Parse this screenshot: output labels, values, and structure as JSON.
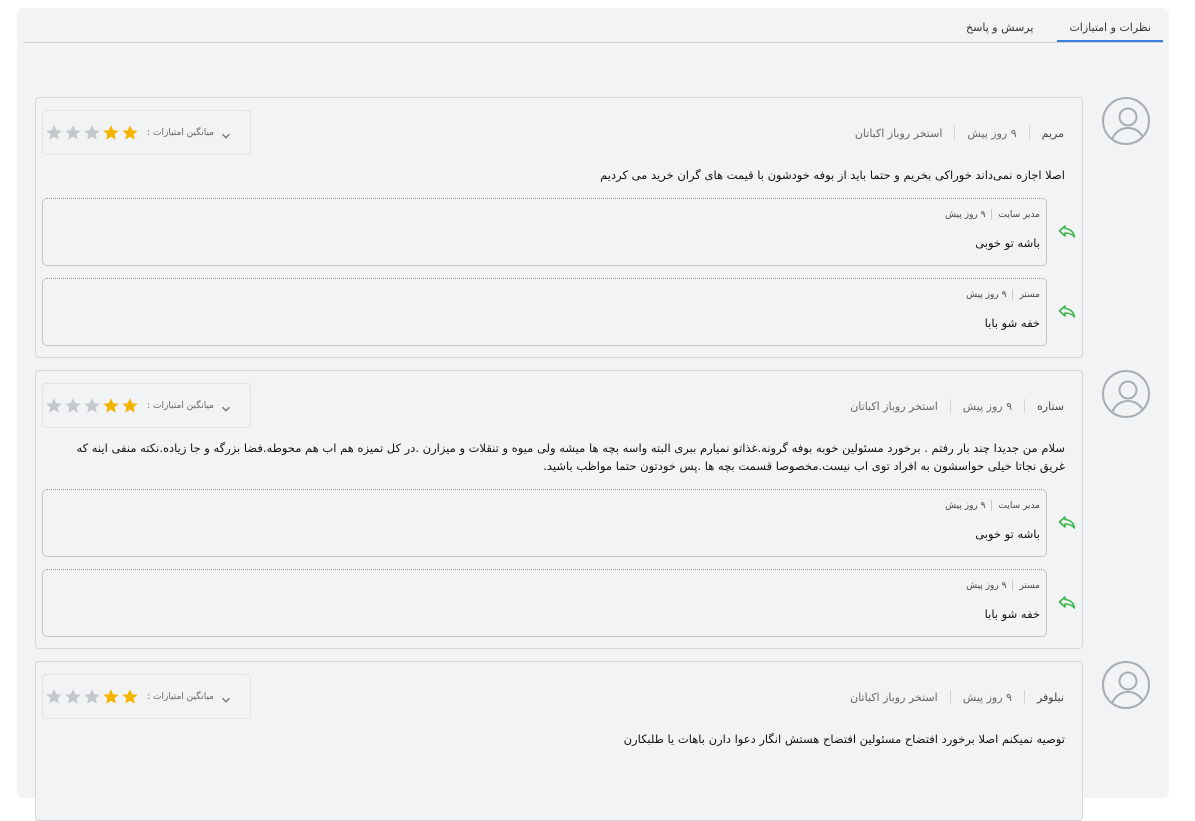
{
  "tabs": [
    {
      "label": "نظرات و امتیازات",
      "active": true
    },
    {
      "label": "پرسش و پاسخ",
      "active": false
    }
  ],
  "colors": {
    "star_filled": "#f5b400",
    "star_empty": "#c4c7cc",
    "reply_icon": "#3bb54a",
    "tab_accent": "#3b7ddd"
  },
  "icons": {
    "avatar": "user-avatar-icon",
    "rating_toggle": "chevron-down-icon",
    "star": "star-icon",
    "reply": "reply-arrow-icon"
  },
  "rating_label": "میانگین امتیازات :",
  "reviews": [
    {
      "author": "مریم",
      "time": "۹ روز پیش",
      "place": "استخر روباز اکباتان",
      "rating": 2,
      "max_rating": 5,
      "text": "اصلا اجازه نمی‌داند خوراکی بخریم و حتما باید از بوفه خودشون با قیمت های گران خرید می کردیم",
      "replies": [
        {
          "author": "مدیر سایت",
          "time": "۹ روز پیش",
          "text": "باشه تو خوبی"
        },
        {
          "author": "مستر",
          "time": "۹ روز پیش",
          "text": "خفه شو بابا"
        }
      ]
    },
    {
      "author": "ستاره",
      "time": "۹ روز پیش",
      "place": "استخر روباز اکباتان",
      "rating": 2,
      "max_rating": 5,
      "text": "سلام من جدیدا چند بار رفتم . برخورد مسئولین خوبه بوفه گرونه.غذاتو نمیارم ببری البته واسه بچه ها میشه ولی میوه و تنقلات و میزارن .در کل تمیزه هم اب هم محوطه.فضا بزرگه و جا زیاده.نکته منفی اینه که غریق نجاتا خیلی حواسشون به افراد توی اب نیست.مخصوصا قسمت بچه ها .پس خودتون حتما مواظب باشید.",
      "replies": [
        {
          "author": "مدیر سایت",
          "time": "۹ روز پیش",
          "text": "باشه تو خوبی"
        },
        {
          "author": "مستر",
          "time": "۹ روز پیش",
          "text": "خفه شو بابا"
        }
      ]
    },
    {
      "author": "نیلوفر",
      "time": "۹ روز پیش",
      "place": "استخر روباز اکباتان",
      "rating": 2,
      "max_rating": 5,
      "text": "توصیه نمیکنم اصلا برخورد افتضاح مسئولین افتضاح هستش انگار دعوا دارن باهات یا طلبکارن",
      "replies": []
    }
  ]
}
